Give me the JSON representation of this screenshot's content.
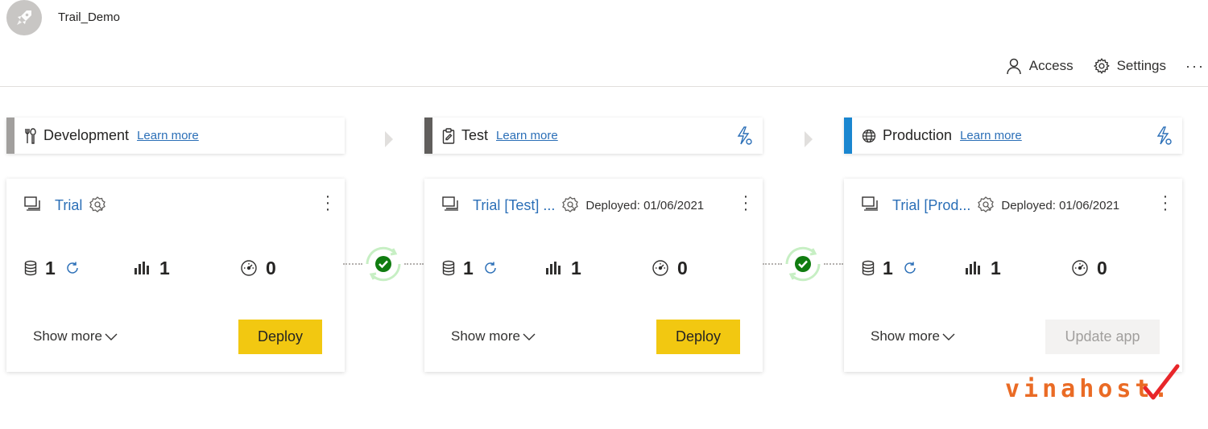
{
  "workspace": {
    "name": "Trail_Demo",
    "icon": "rocket-icon"
  },
  "top_actions": {
    "access_label": "Access",
    "settings_label": "Settings",
    "more_label": "···"
  },
  "stages": [
    {
      "title": "Development",
      "learn_more": "Learn more",
      "color": "#a19f9d",
      "icon": "tools-icon"
    },
    {
      "title": "Test",
      "learn_more": "Learn more",
      "color": "#605e5c",
      "icon": "clipboard-icon"
    },
    {
      "title": "Production",
      "learn_more": "Learn more",
      "color": "#1a86d0",
      "icon": "globe-icon"
    }
  ],
  "cards": [
    {
      "title": "Trial",
      "deployed": "",
      "datasets": "1",
      "reports": "1",
      "dashboards": "0",
      "show_more": "Show more",
      "action_label": "Deploy"
    },
    {
      "title": "Trial [Test] ...",
      "deployed": "Deployed: 01/06/2021",
      "datasets": "1",
      "reports": "1",
      "dashboards": "0",
      "show_more": "Show more",
      "action_label": "Deploy"
    },
    {
      "title": "Trial [Prod...",
      "deployed": "Deployed: 01/06/2021",
      "datasets": "1",
      "reports": "1",
      "dashboards": "0",
      "show_more": "Show more",
      "action_label": "Update app"
    }
  ],
  "colors": {
    "accent": "#f2c811",
    "link": "#2b6fb7",
    "success": "#107c10",
    "sync_ring": "#c7efc4"
  },
  "watermark": {
    "text": "vinahost."
  }
}
